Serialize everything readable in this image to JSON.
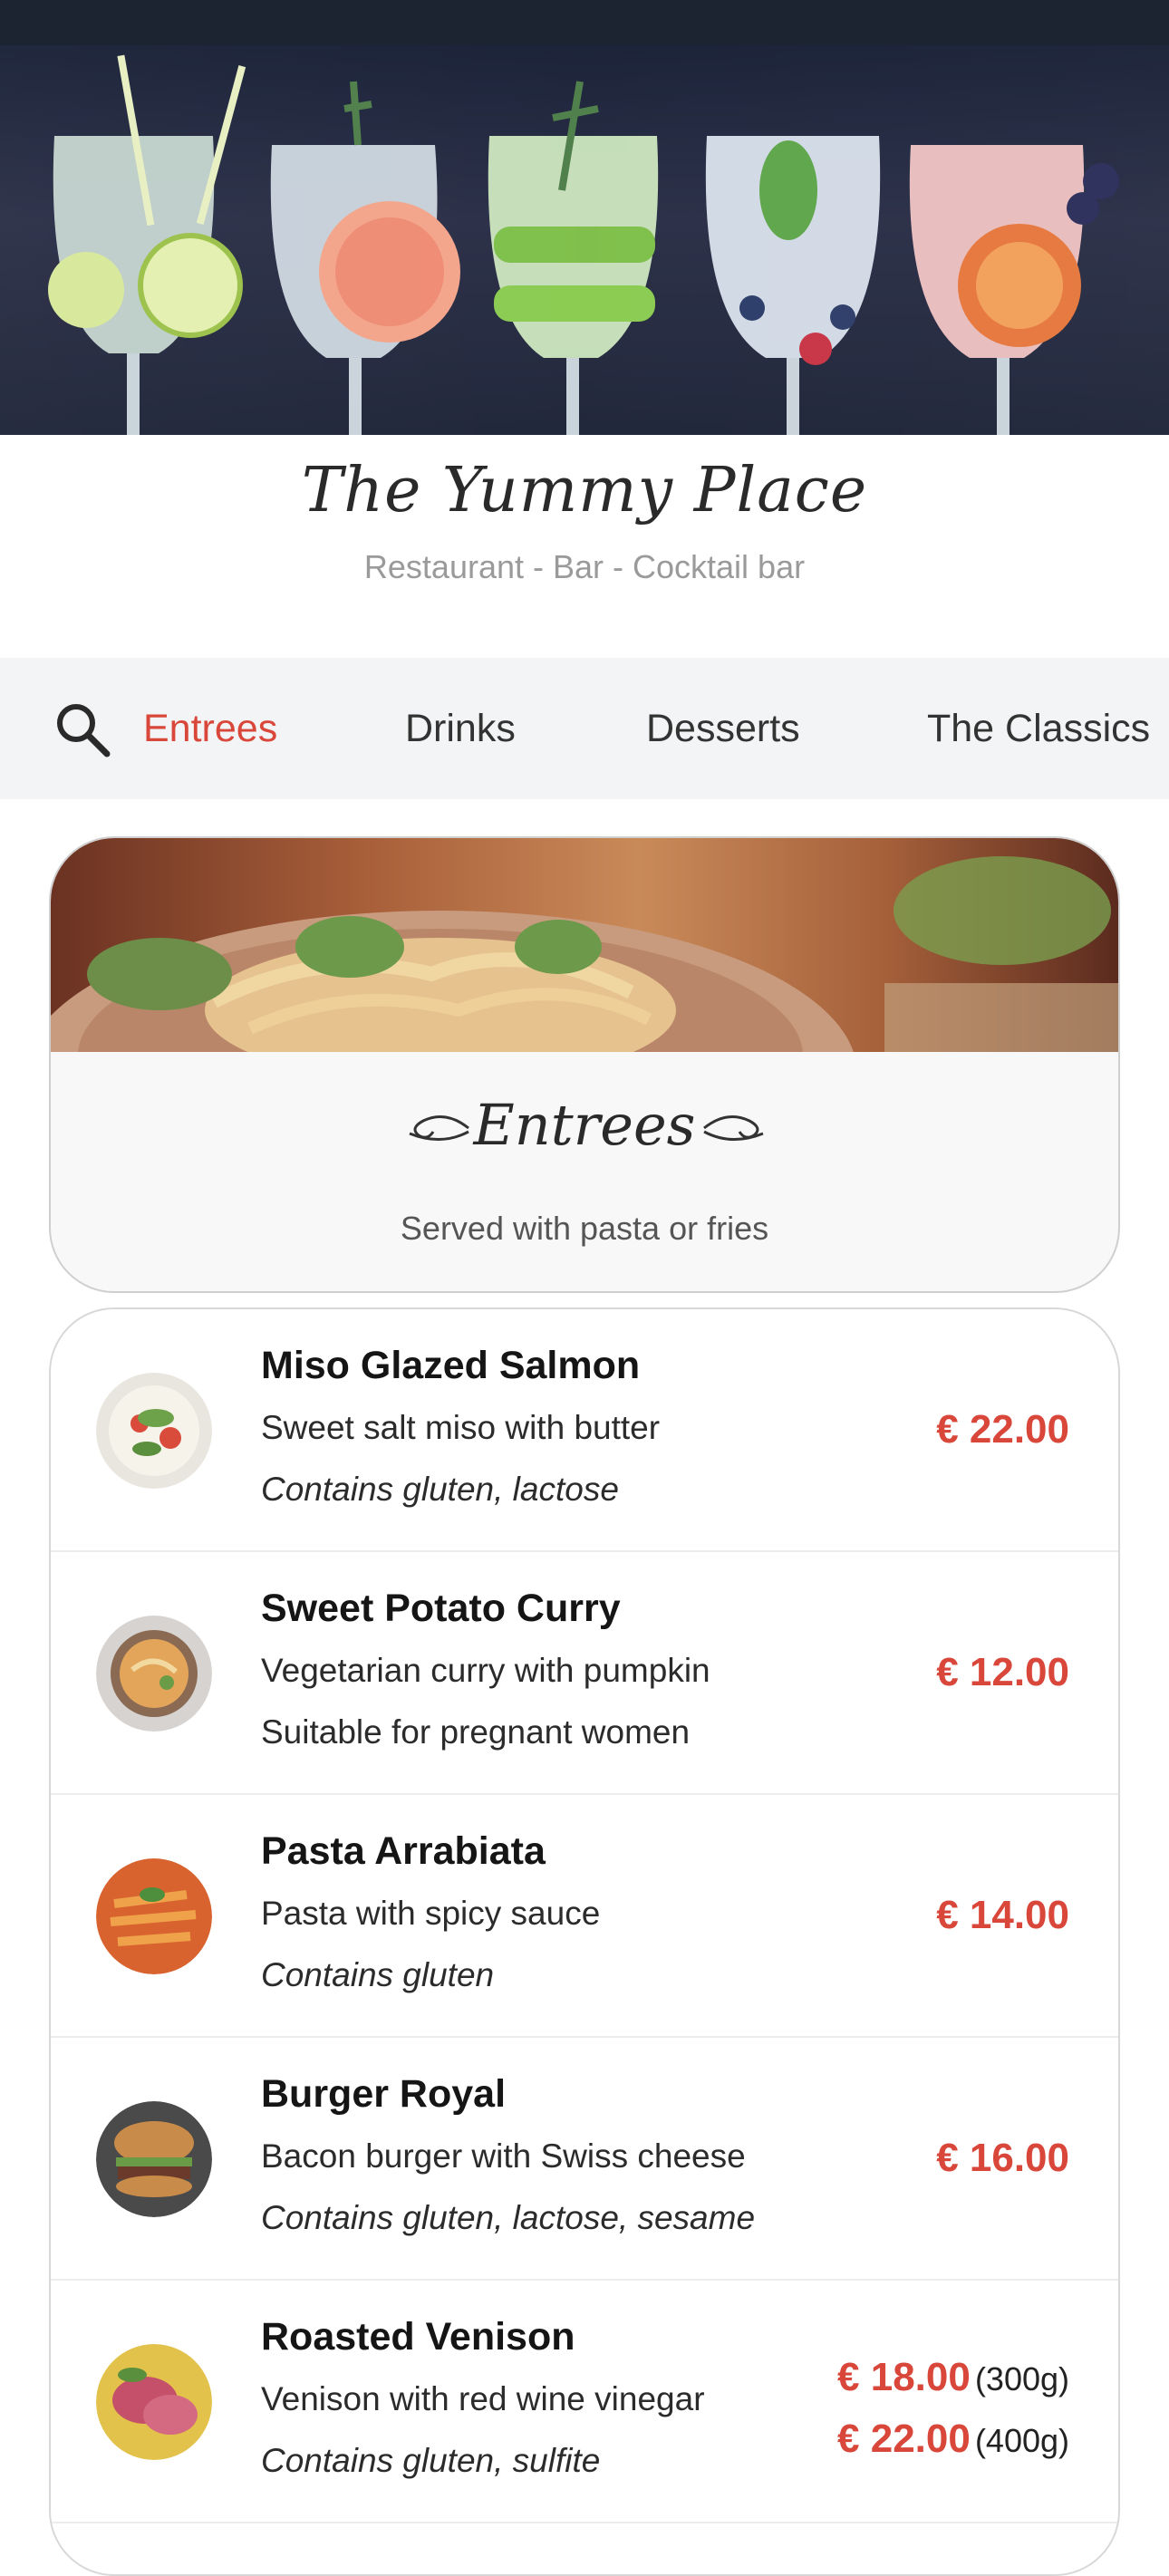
{
  "app": {
    "name": "The Yummy Place",
    "tagline": "Restaurant - Bar - Cocktail bar"
  },
  "colors": {
    "accent": "#d9463a",
    "tab_bar_bg": "#f3f4f5",
    "status_bar": "#1c2432"
  },
  "tabs": [
    {
      "label": "Entrees",
      "active": true
    },
    {
      "label": "Drinks",
      "active": false
    },
    {
      "label": "Desserts",
      "active": false
    },
    {
      "label": "The Classics",
      "active": false
    }
  ],
  "section": {
    "title": "Entrees",
    "subtitle": "Served with pasta or fries"
  },
  "items": [
    {
      "name": "Miso Glazed Salmon",
      "description": "Sweet salt miso with butter",
      "note": "Contains gluten, lactose",
      "note_italic": true,
      "price": "€ 22.00"
    },
    {
      "name": "Sweet Potato Curry",
      "description": "Vegetarian curry with pumpkin",
      "note": "Suitable for pregnant women",
      "note_italic": false,
      "price": "€ 12.00"
    },
    {
      "name": "Pasta Arrabiata",
      "description": "Pasta with spicy sauce",
      "note": "Contains gluten",
      "note_italic": true,
      "price": "€ 14.00"
    },
    {
      "name": "Burger Royal",
      "description": "Bacon burger with Swiss cheese",
      "note": "Contains gluten, lactose, sesame",
      "note_italic": true,
      "price": "€ 16.00"
    },
    {
      "name": "Roasted Venison",
      "description": "Venison with red wine vinegar",
      "note": "Contains gluten, sulfite",
      "note_italic": true,
      "prices": [
        {
          "price": "€ 18.00",
          "size": "(300g)"
        },
        {
          "price": "€ 22.00",
          "size": "(400g)"
        }
      ]
    }
  ],
  "icons": {
    "search": "search-icon",
    "flourish_left": "flourish-left-icon",
    "flourish_right": "flourish-right-icon"
  }
}
